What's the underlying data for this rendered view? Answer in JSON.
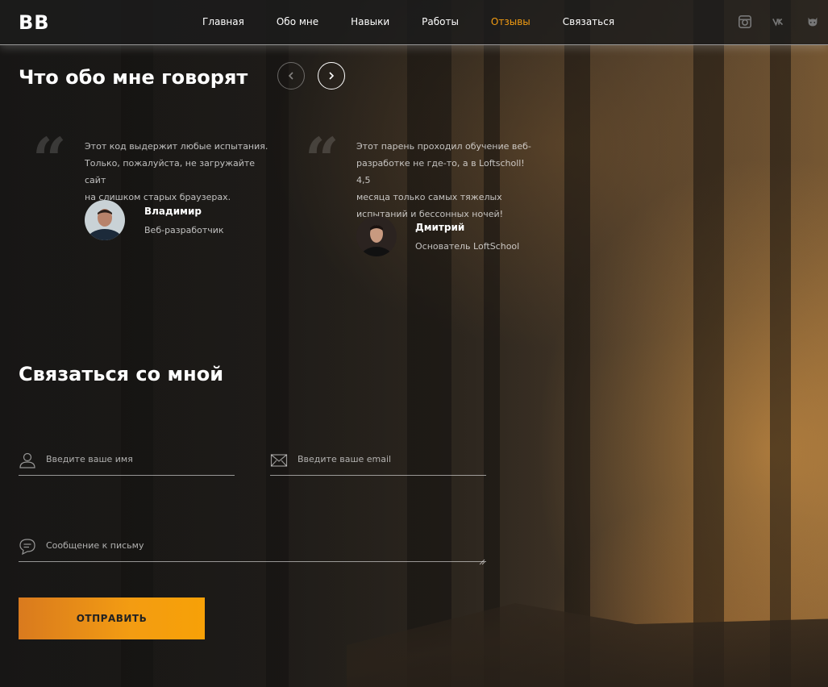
{
  "header": {
    "logo": "BB",
    "nav": [
      {
        "label": "Главная",
        "active": false
      },
      {
        "label": "Обо мне",
        "active": false
      },
      {
        "label": "Навыки",
        "active": false
      },
      {
        "label": "Работы",
        "active": false
      },
      {
        "label": "Отзывы",
        "active": true
      },
      {
        "label": "Связаться",
        "active": false
      }
    ],
    "socials": [
      "instagram-icon",
      "vk-icon",
      "github-icon"
    ]
  },
  "reviews": {
    "title": "Что обо мне говорят",
    "items": [
      {
        "text_lines": [
          "Этот код выдержит любые испытания.",
          "Только, пожалуйста, не загружайте сайт",
          "на слишком старых браузерах."
        ],
        "author": "Владимир",
        "role": "Веб-разработчик"
      },
      {
        "text_lines": [
          "Этот парень проходил обучение веб-",
          "разработке не где-то, а в Loftscholl! 4,5",
          "месяца только самых тяжелых",
          "испытаний и бессонных ночей!"
        ],
        "author": "Дмитрий",
        "role": "Основатель LoftSchool"
      }
    ]
  },
  "contact": {
    "title": "Связаться со мной",
    "name_placeholder": "Введите ваше имя",
    "email_placeholder": "Введите ваше email",
    "message_placeholder": "Сообщение к письму",
    "submit_label": "ОТПРАВИТЬ"
  },
  "colors": {
    "accent": "#f39c12"
  }
}
